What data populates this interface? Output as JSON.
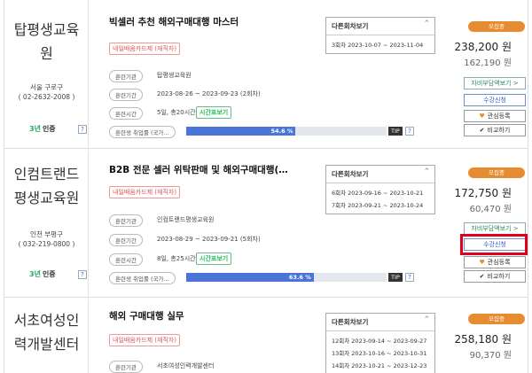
{
  "labels": {
    "org": "훈련기관",
    "period": "훈련기간",
    "hours": "훈련시간",
    "employment": "훈련생 취업률 (국가...",
    "timetable_btn": "시간표보기",
    "card_badge": "내일배움카드제 (재직자)",
    "session_header": "다른회차보기",
    "recruiting": "모집중",
    "cost_btn": "자비부담액보기 >",
    "apply_btn": "수강신청",
    "interest_btn": "관심등록",
    "compare_btn": "비교하기",
    "help": "?",
    "tip": "TIP",
    "cert_prefix": "3년",
    "cert_text": "인증"
  },
  "courses": [
    {
      "institution_lines": [
        "탑평생교육",
        "원"
      ],
      "location_lines": [
        "서울 구로구",
        "( 02-2632-2008 )"
      ],
      "title": "빅셀러 추천 해외구매대행 마스터",
      "org_name": "탑평생교육원",
      "period": "2023-08-26 ~ 2023-09-23 (2회차)",
      "hours": "5일, 총20시간",
      "employment_rate": "54.6 %",
      "employment_value": 54.6,
      "sessions": [
        "3회차 2023-10-07 ~ 2023-11-04"
      ],
      "price": "238,200 원",
      "self_pay": "162,190 원"
    },
    {
      "institution_lines": [
        "인컴트랜드",
        "평생교육원"
      ],
      "location_lines": [
        "인천 부평구",
        "( 032-219-0800 )"
      ],
      "title": "B2B 전문 셀러 위탁판매 및 해외구매대행(…",
      "org_name": "인컴트랜드평생교육원",
      "period": "2023-08-29 ~ 2023-09-21 (5회차)",
      "hours": "8일, 총25시간",
      "employment_rate": "63.6 %",
      "employment_value": 63.6,
      "sessions": [
        "6회차 2023-09-16 ~ 2023-10-21",
        "7회차 2023-09-21 ~ 2023-10-24"
      ],
      "price": "172,750 원",
      "self_pay": "60,470 원"
    },
    {
      "institution_lines": [
        "서초여성인",
        "력개발센터"
      ],
      "title": "해외 구매대행 실무",
      "org_name": "서초여성인력개발센터",
      "sessions": [
        "12회차 2023-09-14 ~ 2023-09-27",
        "13회차 2023-10-16 ~ 2023-10-31",
        "14회차 2023-10-21 ~ 2023-12-23"
      ],
      "price": "258,180 원",
      "self_pay": "90,370 원"
    }
  ]
}
